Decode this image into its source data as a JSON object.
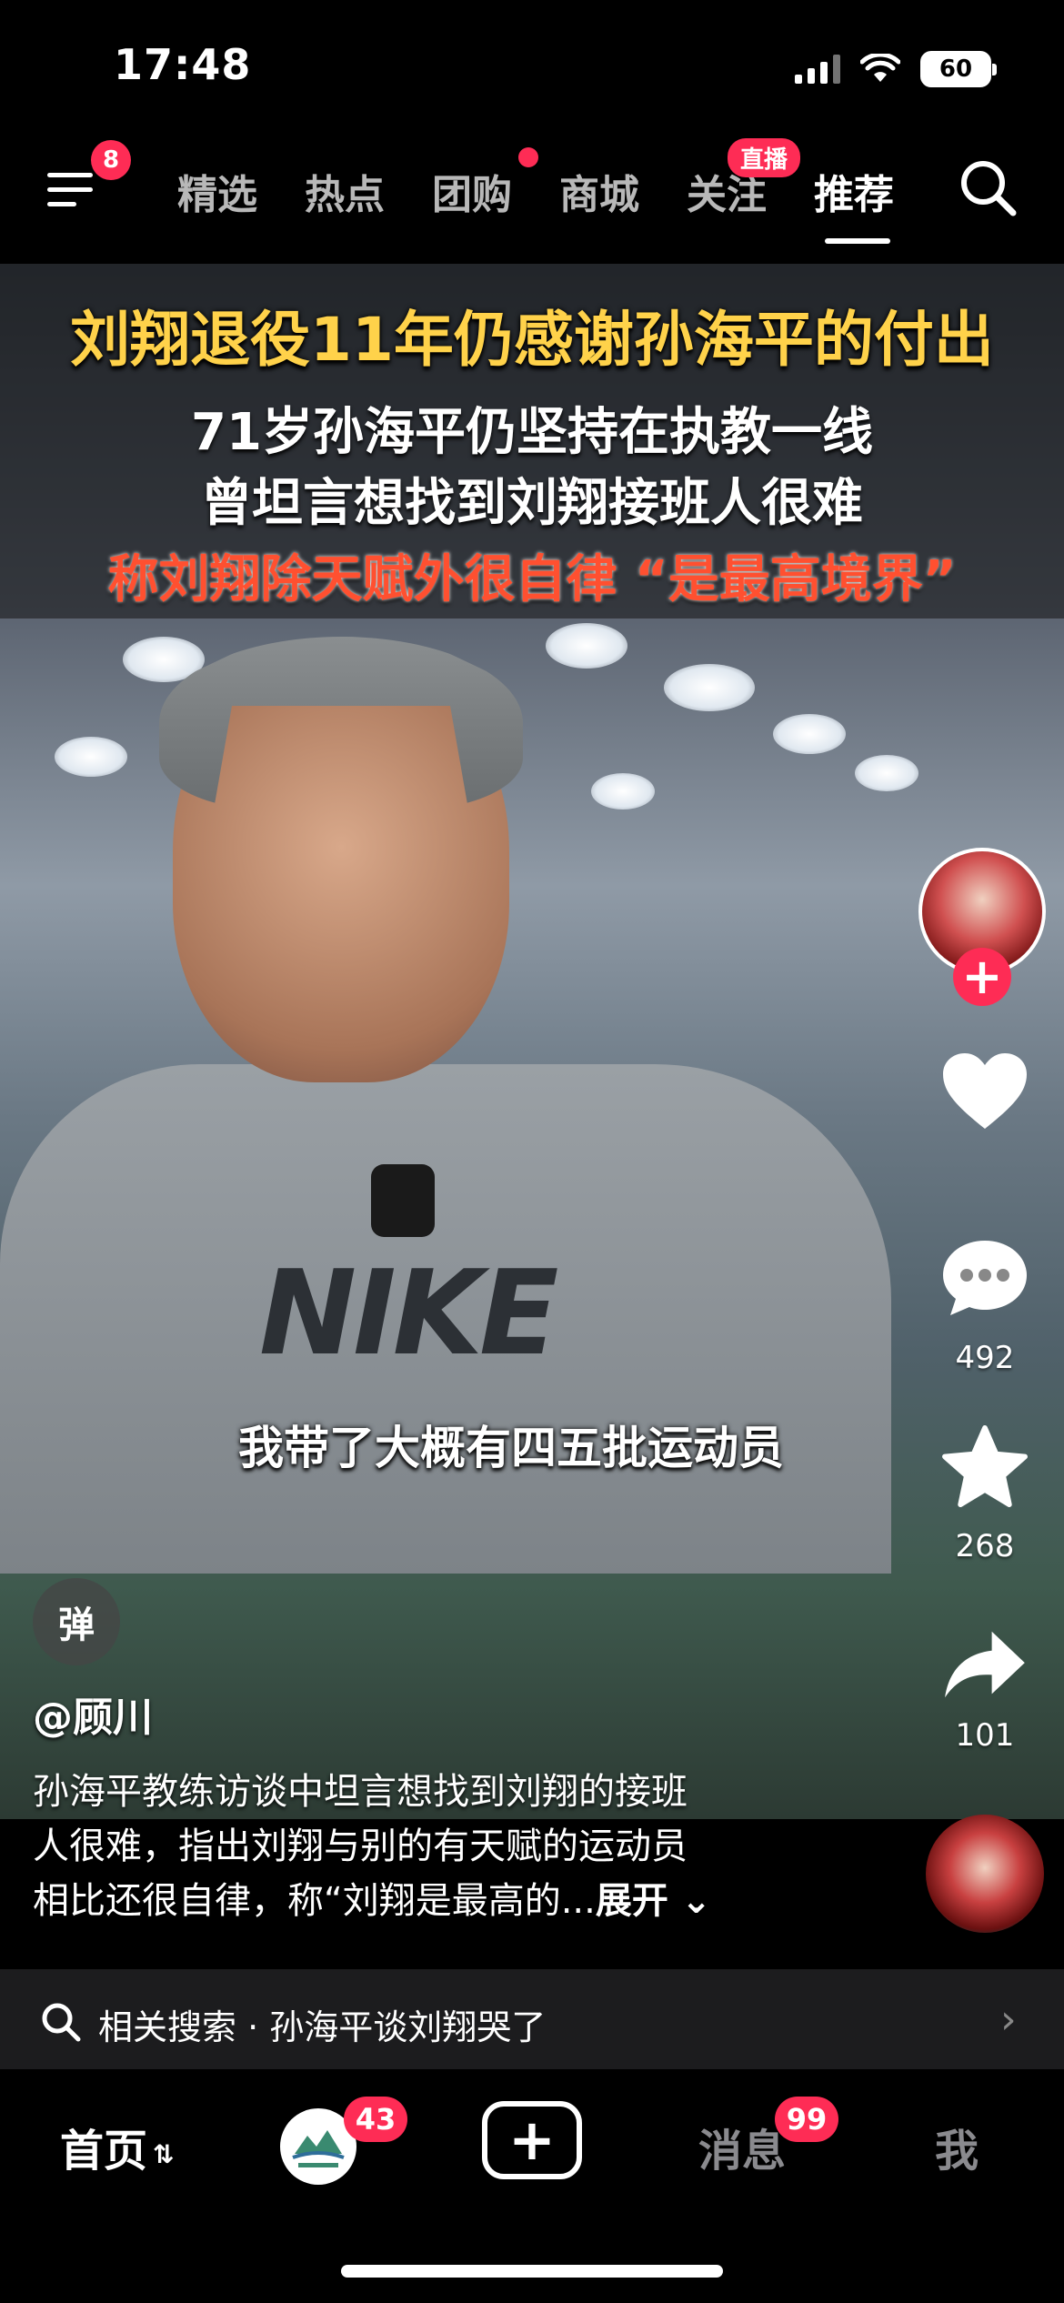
{
  "status_bar": {
    "time": "17:48",
    "battery": "60"
  },
  "top_nav": {
    "menu_badge": "8",
    "live_badge": "直播",
    "tabs": [
      {
        "label": "精选"
      },
      {
        "label": "热点"
      },
      {
        "label": "团购"
      },
      {
        "label": "商城"
      },
      {
        "label": "关注"
      },
      {
        "label": "推荐"
      }
    ],
    "active_tab": "推荐"
  },
  "video": {
    "headline_1": "刘翔退役11年仍感谢孙海平的付出",
    "headline_2": "71岁孙海平仍坚持在执教一线",
    "headline_3": "曾坦言想找到刘翔接班人很难",
    "headline_4": "称刘翔除天赋外很自律 “是最高境界”",
    "shirt_text": "NIKE",
    "subtitle": "我带了大概有四五批运动员"
  },
  "sidebar": {
    "comments": "492",
    "favorites": "268",
    "shares": "101"
  },
  "danmu_label": "弹",
  "author": "@顾川",
  "description": {
    "line1": "孙海平教练访谈中坦言想找到刘翔的接班",
    "line2": "人很难，指出刘翔与别的有天赋的运动员",
    "line3": "相比还很自律，称“刘翔是最高的...",
    "expand": "展开"
  },
  "related_search": {
    "text": "相关搜索 · 孙海平谈刘翔哭了"
  },
  "bottom_nav": {
    "home": "首页",
    "store_badge": "43",
    "messages": "消息",
    "messages_badge": "99",
    "me": "我"
  },
  "colors": {
    "accent": "#fe2c55",
    "headline_yellow": "#ffd24a",
    "headline_red": "#ff5030"
  }
}
